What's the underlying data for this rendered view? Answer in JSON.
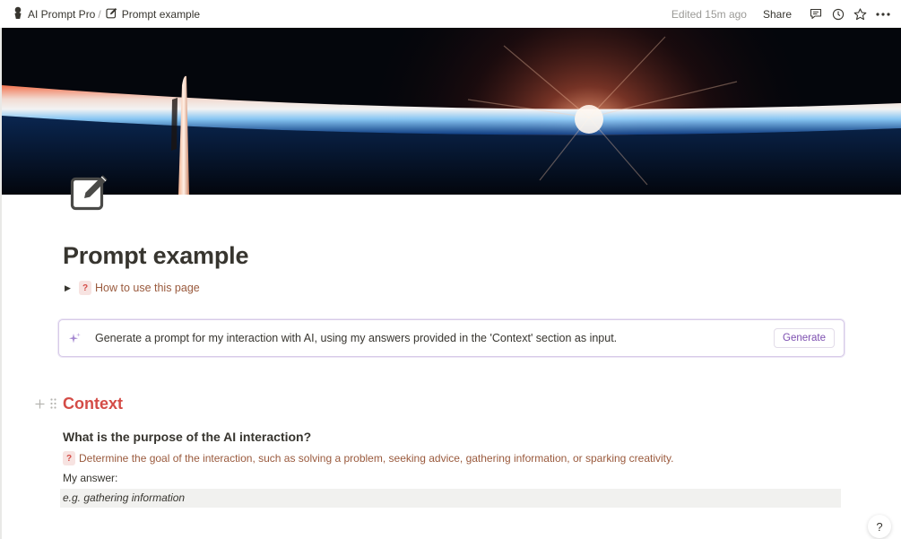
{
  "breadcrumb": {
    "workspace": {
      "label": "AI Prompt Pro",
      "icon": "person-silhouette-icon"
    },
    "separator": "/",
    "page": {
      "label": "Prompt example",
      "icon": "edit-note-icon"
    }
  },
  "topbar": {
    "edited": "Edited 15m ago",
    "share_label": "Share",
    "icons": [
      "comments-icon",
      "history-clock-icon",
      "favorite-star-icon",
      "more-options-icon"
    ]
  },
  "cover": {
    "description_icon": "cover-image"
  },
  "page": {
    "icon": "edit-note-icon",
    "title": "Prompt example",
    "toggle": {
      "badge": "?",
      "label": "How to use this page"
    }
  },
  "ai_block": {
    "icon": "sparkle-icon",
    "text": "Generate a prompt for my interaction with AI, using my answers provided in the 'Context' section as input.",
    "button_label": "Generate"
  },
  "context": {
    "heading": "Context",
    "question": "What is the purpose of the AI interaction?",
    "hint_badge": "?",
    "hint": "Determine the goal of the interaction, such as solving a problem, seeking advice, gathering information, or sparking creativity.",
    "answer_label": "My answer:",
    "answer_placeholder": "e.g. gathering information"
  },
  "help": {
    "label": "?"
  },
  "colors": {
    "heading_red": "#d44c47",
    "hint_brown": "#9a5a3d",
    "generate_purple": "#7d4fb0",
    "text": "#37352f"
  }
}
